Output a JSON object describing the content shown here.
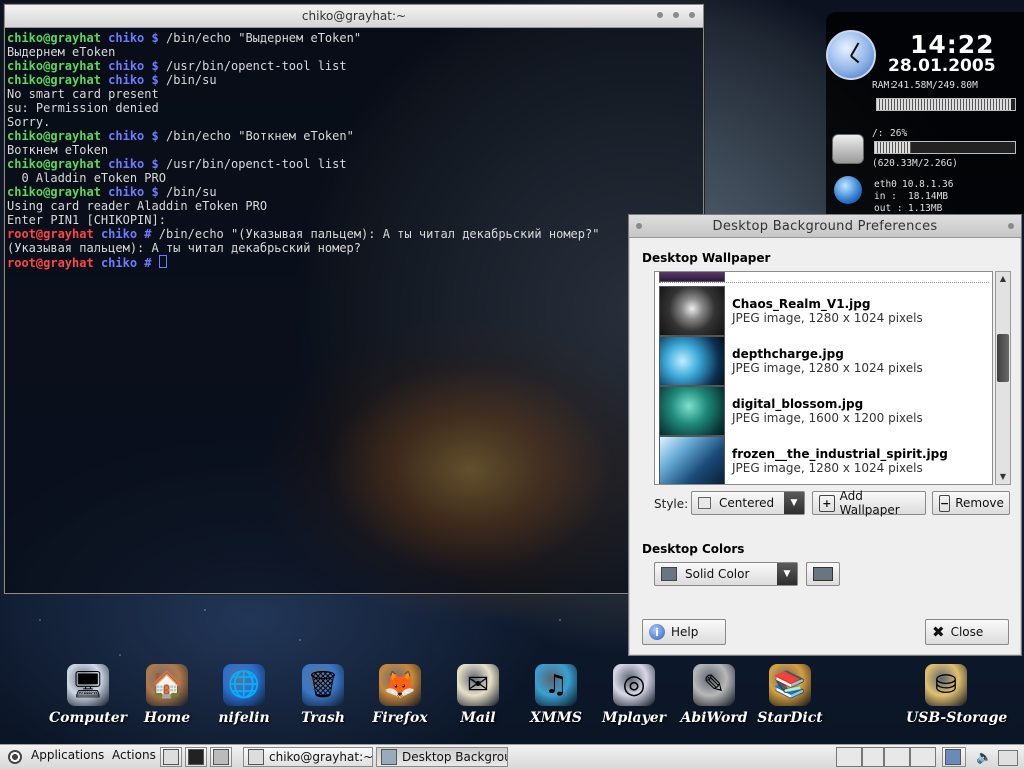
{
  "terminal": {
    "title": "chiko@grayhat:~",
    "lines": [
      {
        "user": "chiko@grayhat",
        "path": "chiko",
        "prompt": "$",
        "cmd": " /bin/echo \"Выдернем eToken\""
      },
      {
        "out": "Выдернем eToken"
      },
      {
        "user": "chiko@grayhat",
        "path": "chiko",
        "prompt": "$",
        "cmd": " /usr/bin/openct-tool list"
      },
      {
        "user": "chiko@grayhat",
        "path": "chiko",
        "prompt": "$",
        "cmd": " /bin/su"
      },
      {
        "out": "No smart card present"
      },
      {
        "out": "su: Permission denied"
      },
      {
        "out": "Sorry."
      },
      {
        "user": "chiko@grayhat",
        "path": "chiko",
        "prompt": "$",
        "cmd": " /bin/echo \"Воткнем eToken\""
      },
      {
        "out": "Воткнем eToken"
      },
      {
        "user": "chiko@grayhat",
        "path": "chiko",
        "prompt": "$",
        "cmd": " /usr/bin/openct-tool list"
      },
      {
        "out": "  0 Aladdin eToken PRO"
      },
      {
        "user": "chiko@grayhat",
        "path": "chiko",
        "prompt": "$",
        "cmd": " /bin/su"
      },
      {
        "out": "Using card reader Aladdin eToken PRO"
      },
      {
        "out": "Enter PIN1 [CHIKOPIN]:"
      },
      {
        "root": "root@grayhat",
        "path": "chiko",
        "prompt": "#",
        "cmd": " /bin/echo \"(Указывая пальцем): А ты читал декабрьский номер?\""
      },
      {
        "out": "(Указывая пальцем): А ты читал декабрьский номер?"
      },
      {
        "root": "root@grayhat",
        "path": "chiko",
        "prompt": "#",
        "cmd": " ",
        "cursor": true
      }
    ]
  },
  "sysmon": {
    "time": "14:22",
    "date": "28.01.2005",
    "ram_label": "RAM:",
    "ram_value": "241.58M/249.80M",
    "ram_fraction": 0.97,
    "disk_label": "/:",
    "disk_pct": "26%",
    "disk_fraction": 0.26,
    "disk_size": "(620.33M/2.26G)",
    "net_iface": "eth0",
    "net_ip": "10.8.1.36",
    "net_in_label": "in :",
    "net_in": "18.14MB",
    "net_out_label": "out :",
    "net_out": "1.13MB"
  },
  "dialog": {
    "title": "Desktop Background Preferences",
    "wallpaper_section": "Desktop Wallpaper",
    "wallpapers": [
      {
        "name": "Chaos_Realm_V1.jpg",
        "meta": "JPEG image, 1280 x 1024 pixels"
      },
      {
        "name": "depthcharge.jpg",
        "meta": "JPEG image, 1280 x 1024 pixels"
      },
      {
        "name": "digital_blossom.jpg",
        "meta": "JPEG image, 1600 x 1200 pixels"
      },
      {
        "name": "frozen__the_industrial_spirit.jpg",
        "meta": "JPEG image, 1280 x 1024 pixels"
      }
    ],
    "style_label": "Style:",
    "style_value": "Centered",
    "add_label": "Add Wallpaper",
    "remove_label": "Remove",
    "colors_section": "Desktop Colors",
    "color_mode": "Solid Color",
    "help_label": "Help",
    "close_label": "Close"
  },
  "launchers": [
    {
      "label": "Computer",
      "icon": "computer-icon",
      "glyph": "🖥",
      "color": "#cfd8e6"
    },
    {
      "label": "Home",
      "icon": "home-icon",
      "glyph": "🏠",
      "color": "#b07a4a"
    },
    {
      "label": "nifelin",
      "icon": "network-icon",
      "glyph": "🌐",
      "color": "#2a6ed0"
    },
    {
      "label": "Trash",
      "icon": "trash-icon",
      "glyph": "🗑",
      "color": "#3a78c8"
    },
    {
      "label": "Firefox",
      "icon": "firefox-icon",
      "glyph": "🦊",
      "color": "#c8873a"
    },
    {
      "label": "Mail",
      "icon": "mail-icon",
      "glyph": "✉",
      "color": "#e8e0c8"
    },
    {
      "label": "XMMS",
      "icon": "xmms-icon",
      "glyph": "♫",
      "color": "#3aa0d0"
    },
    {
      "label": "Mplayer",
      "icon": "mplayer-icon",
      "glyph": "◎",
      "color": "#d8d8e8"
    },
    {
      "label": "AbiWord",
      "icon": "abiword-icon",
      "glyph": "✎",
      "color": "#b8b8b8"
    },
    {
      "label": "StarDict",
      "icon": "stardict-icon",
      "glyph": "📚",
      "color": "#d8a040"
    },
    {
      "label": "USB-Storage",
      "icon": "usb-storage-icon",
      "glyph": "⛁",
      "color": "#e0c070"
    }
  ],
  "panel": {
    "applications": "Applications",
    "actions": "Actions",
    "task_terminal": "chiko@grayhat:~",
    "task_dialog": "Desktop Backgroun"
  }
}
